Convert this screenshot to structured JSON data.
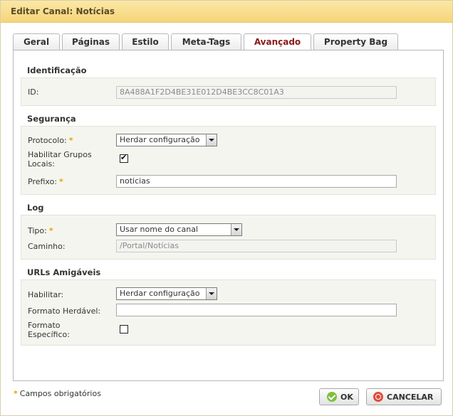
{
  "dialog": {
    "title": "Editar Canal: Notícias"
  },
  "tabs": [
    {
      "label": "Geral"
    },
    {
      "label": "Páginas"
    },
    {
      "label": "Estilo"
    },
    {
      "label": "Meta-Tags"
    },
    {
      "label": "Avançado",
      "active": true
    },
    {
      "label": "Property Bag"
    }
  ],
  "identificacao": {
    "title": "Identificação",
    "id_label": "ID:",
    "id_value": "8A488A1F2D4BE31E012D4BE3CC8C01A3"
  },
  "seguranca": {
    "title": "Segurança",
    "protocolo_label": "Protocolo:",
    "protocolo_value": "Herdar configuração",
    "grupos_label": "Habilitar Grupos Locais:",
    "grupos_checked": true,
    "grupos_mark": "✔",
    "prefixo_label": "Prefixo:",
    "prefixo_value": "noticias"
  },
  "log": {
    "title": "Log",
    "tipo_label": "Tipo:",
    "tipo_value": "Usar nome do canal",
    "caminho_label": "Caminho:",
    "caminho_value": "/Portal/Notícias"
  },
  "urls": {
    "title": "URLs Amigáveis",
    "habilitar_label": "Habilitar:",
    "habilitar_value": "Herdar configuração",
    "formato_herdavel_label": "Formato Herdável:",
    "formato_herdavel_value": "",
    "formato_especifico_label": "Formato Específico:",
    "formato_especifico_checked": false
  },
  "footer": {
    "required_star": "*",
    "required_note": "Campos obrigatórios",
    "ok_label": "OK",
    "cancel_label": "CANCELAR"
  },
  "required_marker": "*",
  "colors": {
    "titlebar": "#f6d57a",
    "active_tab_text": "#8a1a1a",
    "required": "#e6a100",
    "ok_icon": "#7fbf3f",
    "cancel_icon": "#e04b3a"
  }
}
